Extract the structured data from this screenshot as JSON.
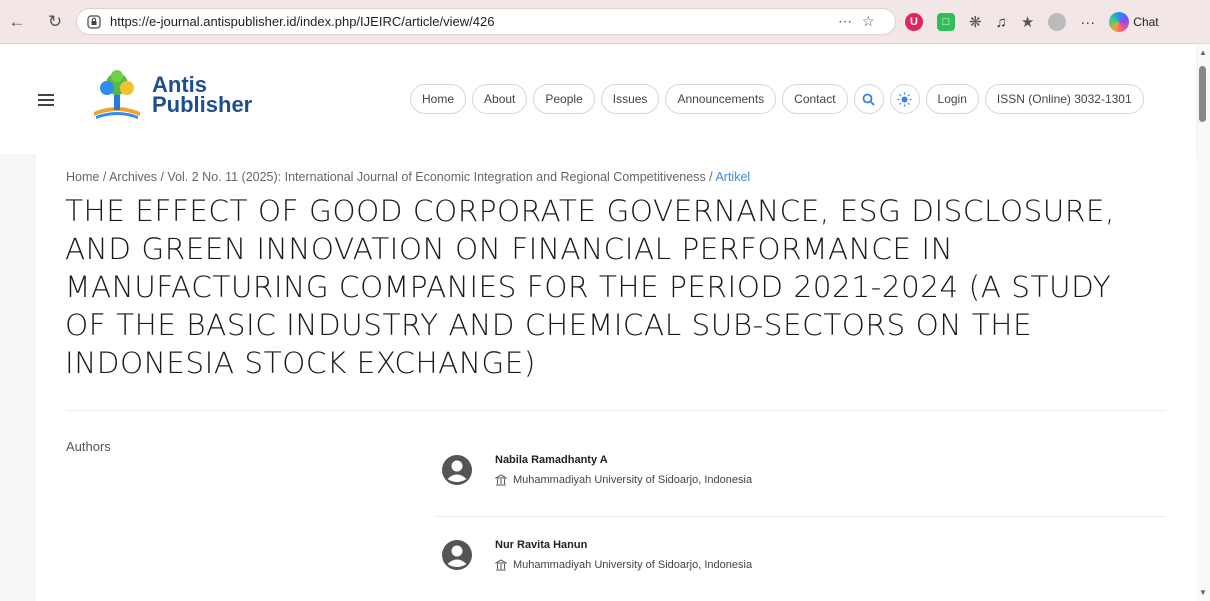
{
  "browser": {
    "url": "https://e-journal.antispublisher.id/index.php/IJEIRC/article/view/426",
    "chat_label": "Chat",
    "more_label": "···"
  },
  "site": {
    "logo_line1": "Antis",
    "logo_line2": "Publisher",
    "nav": [
      "Home",
      "About",
      "People",
      "Issues",
      "Announcements",
      "Contact",
      "Login",
      "ISSN (Online) 3032-1301"
    ],
    "search_icon": "search-icon",
    "theme_icon": "sun-icon"
  },
  "article": {
    "breadcrumb": "Home / Archives / Vol. 2 No. 11 (2025): International Journal of Economic Integration and Regional Competitiveness / ",
    "breadcrumb_current": "Artikel",
    "title": "THE EFFECT OF GOOD CORPORATE GOVERNANCE, ESG DISCLOSURE, AND GREEN INNOVATION ON FINANCIAL PERFORMANCE IN MANUFACTURING COMPANIES FOR THE PERIOD 2021-2024 (A STUDY OF THE BASIC INDUSTRY AND CHEMICAL SUB-SECTORS ON THE INDONESIA STOCK EXCHANGE)",
    "authors_label": "Authors",
    "authors": [
      {
        "name": "Nabila Ramadhanty A",
        "affiliation": "Muhammadiyah University of Sidoarjo, Indonesia"
      },
      {
        "name": "Nur Ravita Hanun",
        "affiliation": "Muhammadiyah University of Sidoarjo, Indonesia"
      }
    ]
  },
  "colors": {
    "browser_bar": "#f3e6e6",
    "link": "#3a8be0",
    "logo": "#1d4e8f"
  }
}
